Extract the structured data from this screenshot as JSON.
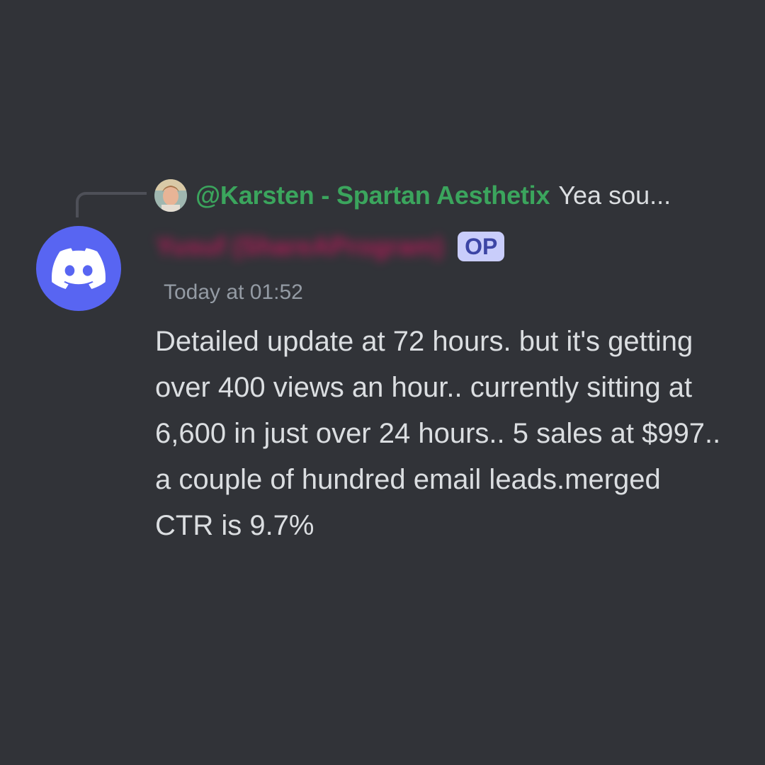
{
  "reply": {
    "mention": "@Karsten - Spartan Aesthetix",
    "snippet": "Yea sou..."
  },
  "message": {
    "author": "Yusuf (ShareAProgram)",
    "badge": "OP",
    "timestamp": "Today at 01:52",
    "text": "Detailed update at 72 hours. but it's getting over 400 views an hour.. currently sitting at 6,600 in just over 24 hours.. 5 sales at $997.. a couple of hundred email leads.merged CTR is 9.7%"
  },
  "icons": {
    "main_avatar": "discord-logo-icon",
    "reply_avatar": "user-photo-avatar"
  },
  "colors": {
    "background": "#313338",
    "brand": "#5865f2",
    "mention": "#3ba55d",
    "author": "#c2185b",
    "badge_bg": "#c9cdfb",
    "badge_text": "#3c45a5",
    "timestamp": "#949ba4",
    "text": "#dbdee1"
  }
}
